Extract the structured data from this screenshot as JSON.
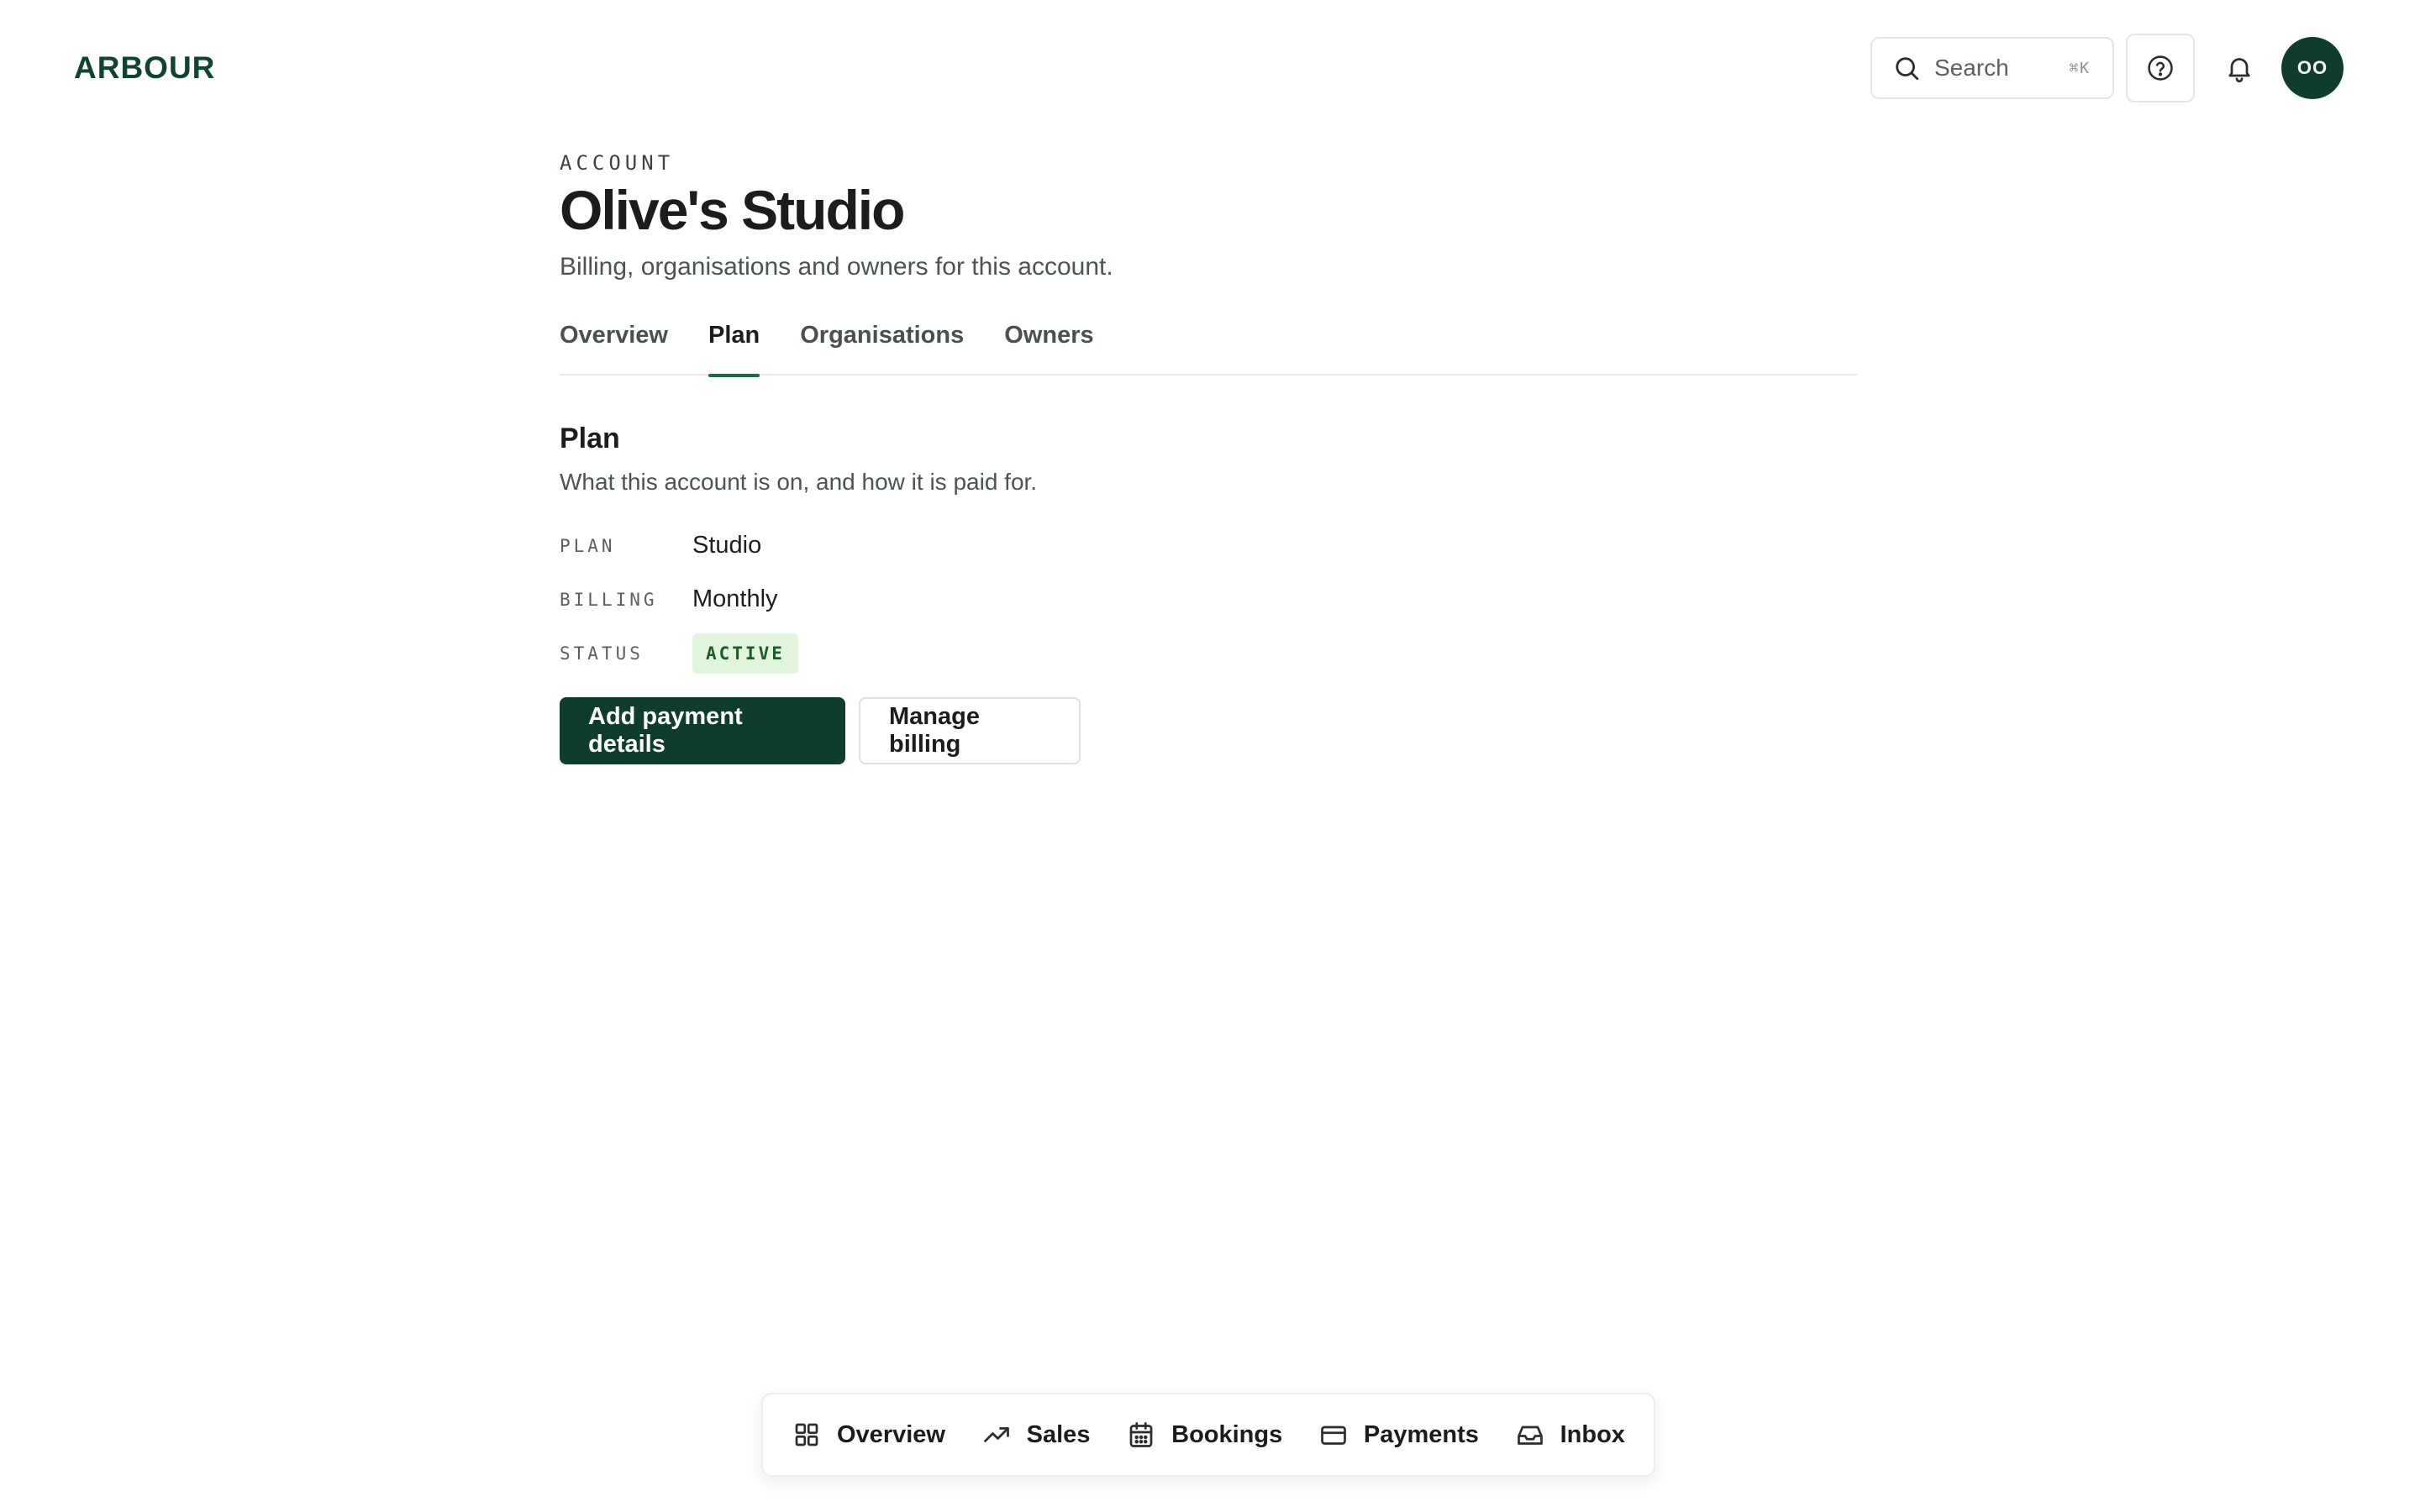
{
  "header": {
    "logo": "ARBOUR",
    "search": {
      "placeholder": "Search",
      "shortcut": "⌘K"
    },
    "avatar_initials": "OO"
  },
  "page": {
    "eyebrow": "ACCOUNT",
    "title": "Olive's Studio",
    "subtitle": "Billing, organisations and owners for this account."
  },
  "tabs": [
    {
      "label": "Overview",
      "active": false
    },
    {
      "label": "Plan",
      "active": true
    },
    {
      "label": "Organisations",
      "active": false
    },
    {
      "label": "Owners",
      "active": false
    }
  ],
  "plan_section": {
    "title": "Plan",
    "description": "What this account is on, and how it is paid for.",
    "fields": [
      {
        "label": "PLAN",
        "value": "Studio"
      },
      {
        "label": "BILLING",
        "value": "Monthly"
      },
      {
        "label": "STATUS",
        "value": "ACTIVE"
      }
    ],
    "primary_action": "Add payment details",
    "secondary_action": "Manage billing"
  },
  "bottom_nav": [
    {
      "label": "Overview",
      "icon": "grid-icon"
    },
    {
      "label": "Sales",
      "icon": "trending-up-icon"
    },
    {
      "label": "Bookings",
      "icon": "calendar-icon"
    },
    {
      "label": "Payments",
      "icon": "credit-card-icon"
    },
    {
      "label": "Inbox",
      "icon": "inbox-icon"
    }
  ],
  "colors": {
    "brand": "#0f3d2c",
    "tab_underline": "#1f6a4b",
    "status_badge_bg": "#e0f5dc",
    "status_badge_text": "#1e5a2a"
  }
}
